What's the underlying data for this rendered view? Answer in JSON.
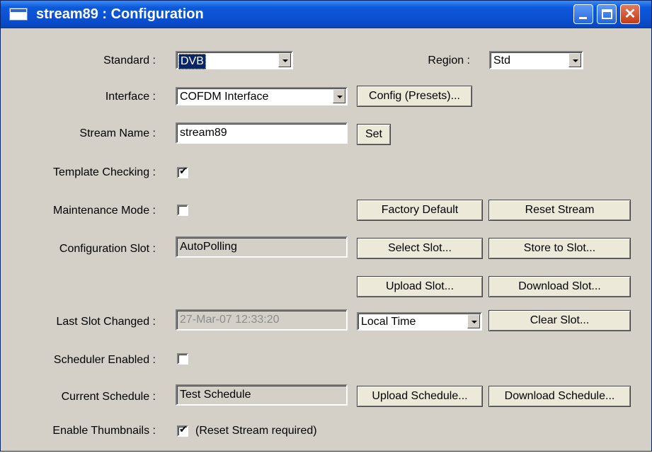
{
  "window": {
    "title": "stream89 : Configuration"
  },
  "standard": {
    "label": "Standard :",
    "value": "DVB"
  },
  "region": {
    "label": "Region :",
    "value": "Std"
  },
  "interface": {
    "label": "Interface :",
    "value": "COFDM Interface",
    "config_button": "Config (Presets)..."
  },
  "stream_name": {
    "label": "Stream Name :",
    "value": "stream89",
    "set_button": "Set"
  },
  "template_checking": {
    "label": "Template Checking :",
    "checked": true
  },
  "maintenance_mode": {
    "label": "Maintenance Mode :",
    "checked": false,
    "factory_default_button": "Factory Default",
    "reset_stream_button": "Reset Stream"
  },
  "configuration_slot": {
    "label": "Configuration Slot :",
    "value": "AutoPolling",
    "select_slot_button": "Select Slot...",
    "store_slot_button": "Store to Slot...",
    "upload_slot_button": "Upload Slot...",
    "download_slot_button": "Download Slot..."
  },
  "last_slot_changed": {
    "label": "Last Slot Changed :",
    "value": "27-Mar-07 12:33:20",
    "time_mode": "Local Time",
    "clear_slot_button": "Clear Slot..."
  },
  "scheduler_enabled": {
    "label": "Scheduler Enabled :",
    "checked": false
  },
  "current_schedule": {
    "label": "Current Schedule :",
    "value": "Test Schedule",
    "upload_schedule_button": "Upload Schedule...",
    "download_schedule_button": "Download Schedule..."
  },
  "enable_thumbnails": {
    "label": "Enable Thumbnails :",
    "checked": true,
    "note": "(Reset Stream required)"
  },
  "colors": {
    "titlebar": "#0a4fd0",
    "dialog_bg": "#d4d0c8",
    "selection": "#0a246a",
    "close_button": "#c33b15"
  }
}
